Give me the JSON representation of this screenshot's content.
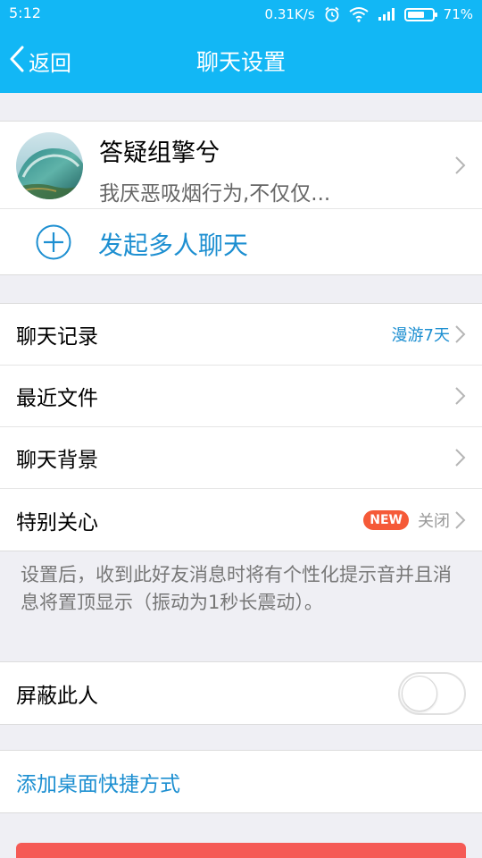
{
  "status": {
    "time": "5:12",
    "speed": "0.31K/s",
    "battery": "71%",
    "battery_level": 0.71
  },
  "nav": {
    "back_label": "返回",
    "title": "聊天设置"
  },
  "profile": {
    "name": "答疑组擎兮",
    "signature": "我厌恶吸烟行为,不仅仅..."
  },
  "group_chat": {
    "label": "发起多人聊天"
  },
  "settings": {
    "chat_history": {
      "label": "聊天记录",
      "value": "漫游7天"
    },
    "recent_files": {
      "label": "最近文件"
    },
    "chat_background": {
      "label": "聊天背景"
    },
    "special_care": {
      "label": "特别关心",
      "badge": "NEW",
      "value": "关闭"
    }
  },
  "note": "设置后，收到此好友消息时将有个性化提示音并且消息将置顶显示（振动为1秒长震动）。",
  "block": {
    "label": "屏蔽此人",
    "enabled": false
  },
  "shortcut": {
    "label": "添加桌面快捷方式"
  },
  "colors": {
    "accent": "#12b7f5",
    "link": "#1d8fd1",
    "badge": "#f55a38",
    "danger": "#f55a55"
  }
}
